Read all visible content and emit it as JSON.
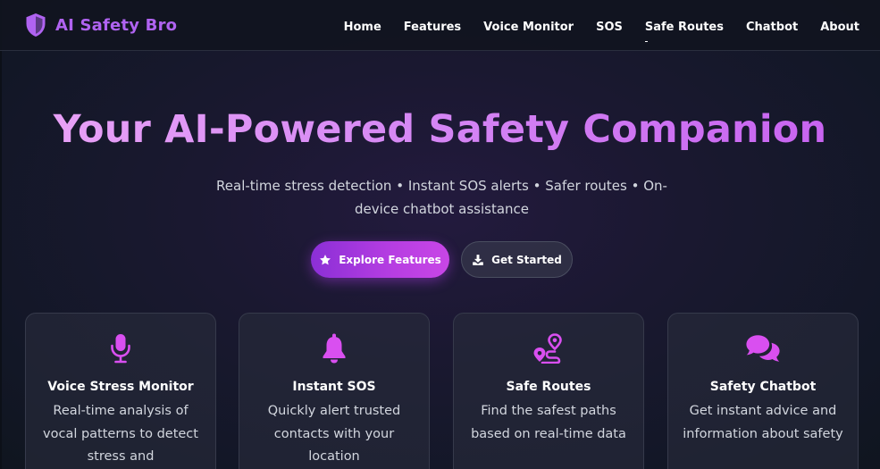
{
  "brand": {
    "name": "AI Safety Bro",
    "icon": "shield-icon",
    "color": "#b063f1"
  },
  "nav": {
    "items": [
      {
        "label": "Home"
      },
      {
        "label": "Features"
      },
      {
        "label": "Voice Monitor"
      },
      {
        "label": "SOS"
      },
      {
        "label": "Safe Routes"
      },
      {
        "label": "Chatbot"
      },
      {
        "label": "About"
      }
    ]
  },
  "hero": {
    "title": "Your AI-Powered Safety Companion",
    "subtitle": "Real-time stress detection • Instant SOS alerts • Safer routes • On-device chatbot assistance",
    "primary_button": {
      "label": "Explore Features",
      "icon": "star-icon"
    },
    "secondary_button": {
      "label": "Get Started",
      "icon": "download-icon"
    }
  },
  "features": [
    {
      "icon": "microphone-icon",
      "title": "Voice Stress Monitor",
      "description": "Real-time analysis of vocal patterns to detect stress and"
    },
    {
      "icon": "bell-icon",
      "title": "Instant SOS",
      "description": "Quickly alert trusted contacts with your location"
    },
    {
      "icon": "route-icon",
      "title": "Safe Routes",
      "description": "Find the safest paths based on real-time data"
    },
    {
      "icon": "chat-bubbles-icon",
      "title": "Safety Chatbot",
      "description": "Get instant advice and information about safety"
    }
  ],
  "colors": {
    "accent": "#c846e6",
    "icon": "#d94ff0",
    "background": "#151a28"
  }
}
